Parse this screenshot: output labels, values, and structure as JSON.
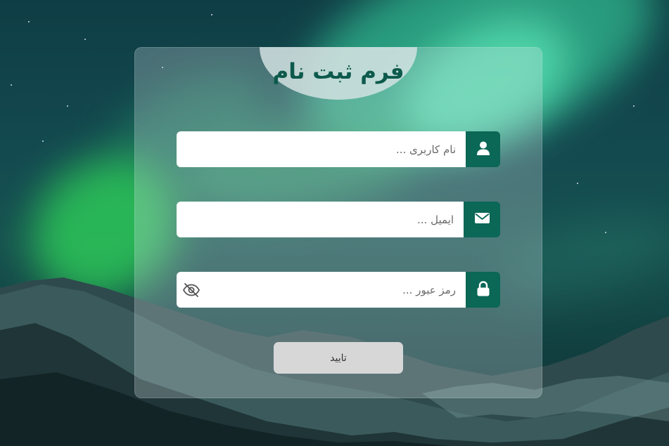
{
  "form": {
    "title": "فرم ثبت نام",
    "username": {
      "placeholder": "نام کاربری ...",
      "value": ""
    },
    "email": {
      "placeholder": "ایمیل ...",
      "value": ""
    },
    "password": {
      "placeholder": "رمز عبور ...",
      "value": ""
    },
    "submit_label": "تایید"
  },
  "icons": {
    "username": "user-icon",
    "email": "envelope-icon",
    "password": "lock-icon",
    "toggle_password": "eye-slash-icon"
  },
  "colors": {
    "accent": "#0b6756",
    "title": "#0d5a4c",
    "submit_bg": "#d7d7d7"
  }
}
